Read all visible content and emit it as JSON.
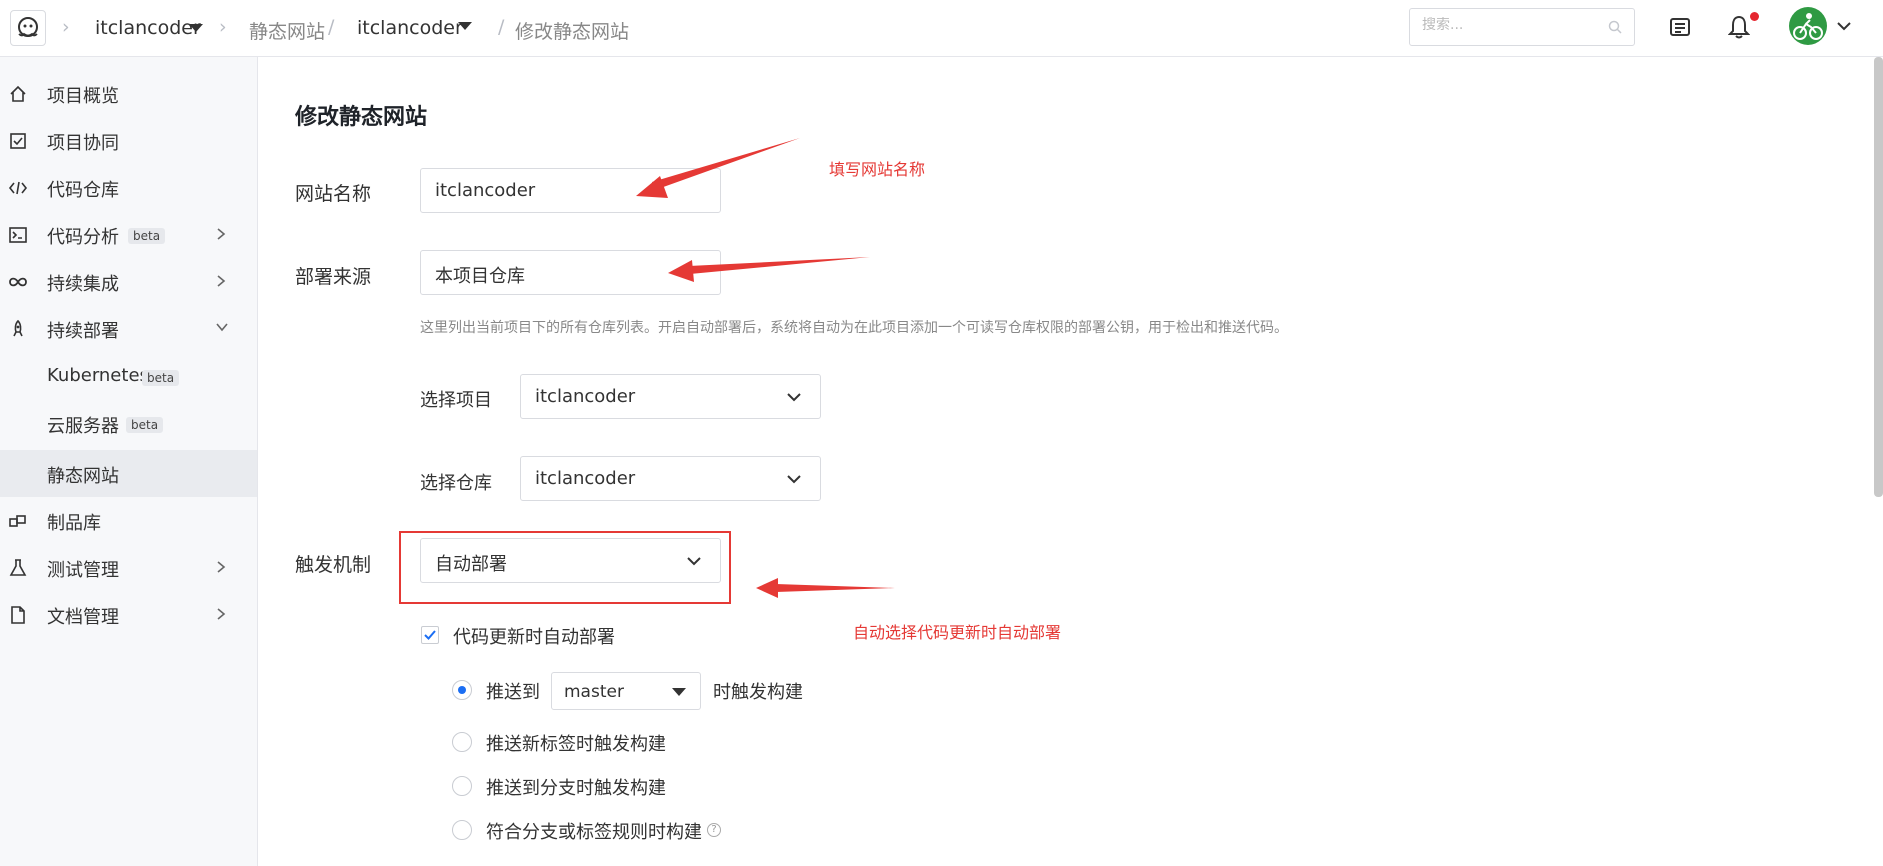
{
  "breadcrumb": {
    "project": "itclancoder",
    "section": "静态网站",
    "site": "itclancoder",
    "page": "修改静态网站"
  },
  "search": {
    "placeholder": "搜索..."
  },
  "sidebar": {
    "items": [
      {
        "label": "项目概览",
        "icon": "home-icon"
      },
      {
        "label": "项目协同",
        "icon": "checkbox-icon"
      },
      {
        "label": "代码仓库",
        "icon": "code-icon"
      },
      {
        "label": "代码分析",
        "icon": "terminal-icon",
        "badge": "beta"
      },
      {
        "label": "持续集成",
        "icon": "infinity-icon"
      },
      {
        "label": "持续部署",
        "icon": "rocket-icon"
      },
      {
        "label": "Kubernetes",
        "badge": "beta"
      },
      {
        "label": "云服务器",
        "badge": "beta"
      },
      {
        "label": "静态网站",
        "active": true
      },
      {
        "label": "制品库",
        "icon": "package-icon"
      },
      {
        "label": "测试管理",
        "icon": "flask-icon"
      },
      {
        "label": "文档管理",
        "icon": "document-icon"
      }
    ]
  },
  "form": {
    "title": "修改静态网站",
    "site_name_label": "网站名称",
    "site_name_value": "itclancoder",
    "source_label": "部署来源",
    "source_value": "本项目仓库",
    "source_hint": "这里列出当前项目下的所有仓库列表。开启自动部署后，系统将自动为在此项目添加一个可读写仓库权限的部署公钥，用于检出和推送代码。",
    "project_label": "选择项目",
    "project_value": "itclancoder",
    "repo_label": "选择仓库",
    "repo_value": "itclancoder",
    "trigger_label": "触发机制",
    "trigger_value": "自动部署",
    "auto_deploy_checkbox": "代码更新时自动部署",
    "auto_deploy_checked": true,
    "push_to_label": "推送到",
    "branch_value": "master",
    "push_to_suffix": "时触发构建",
    "options": [
      "推送新标签时触发构建",
      "推送到分支时触发构建",
      "符合分支或标签规则时构建"
    ],
    "help_mark": "?"
  },
  "annotations": {
    "site_name_note": "填写网站名称",
    "trigger_note": "自动选择代码更新时自动部署"
  },
  "colors": {
    "accent": "#1b6ef3",
    "annotation_red": "#e53935",
    "notify_dot": "#e5262f",
    "avatar_green": "#2f9a43"
  }
}
